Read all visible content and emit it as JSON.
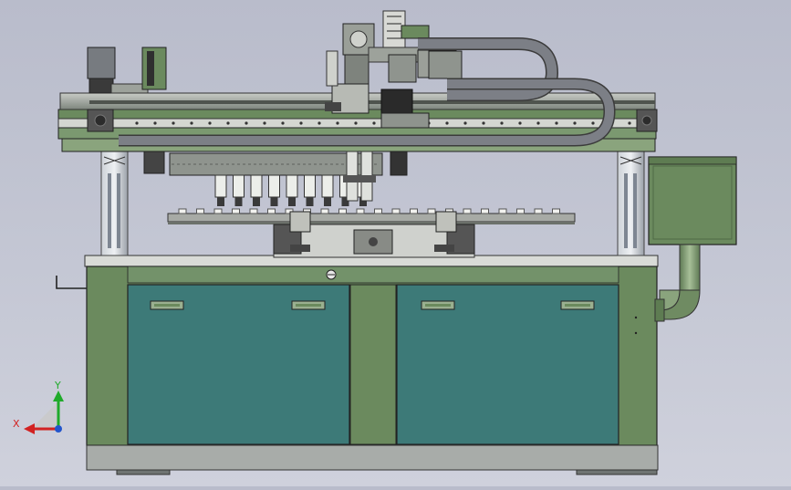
{
  "viewport": {
    "background_color": "#c2c5d2"
  },
  "machine": {
    "frame_color": "#6b8a5e",
    "door_color": "#3d7a78",
    "rail_color": "#9aa39a",
    "dark_color": "#333333",
    "cable_chain_color": "#7c7f86",
    "axis_module_color": "#2a2a2a",
    "electrical_box_color": "#6b8a5e",
    "pipe_color": "#7f9a73",
    "gripper_count": 9,
    "tray_slot_count": 22
  },
  "triad": {
    "x_label": "X",
    "y_label": "Y",
    "x_color": "#d22222",
    "y_color": "#1faa2a",
    "z_color": "#2255cc"
  }
}
